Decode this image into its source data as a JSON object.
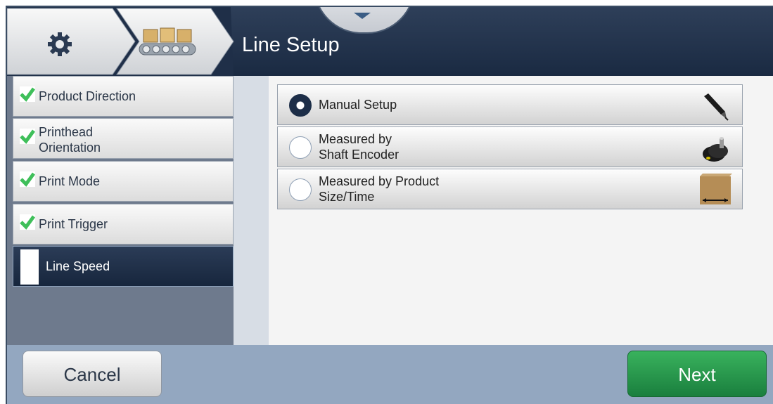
{
  "header": {
    "title": "Line Setup",
    "settings_icon": "gear-icon",
    "line_icon": "conveyor-icon"
  },
  "sidebar": {
    "items": [
      {
        "label": "Product Direction",
        "status": "complete"
      },
      {
        "label": "Printhead\nOrientation",
        "status": "complete"
      },
      {
        "label": "Print Mode",
        "status": "complete"
      },
      {
        "label": "Print Trigger",
        "status": "complete"
      },
      {
        "label": "Line Speed",
        "status": "active"
      }
    ]
  },
  "options": [
    {
      "label": "Manual Setup",
      "selected": true,
      "icon": "pen-icon"
    },
    {
      "label": "Measured by\nShaft Encoder",
      "selected": false,
      "icon": "shaft-encoder-icon"
    },
    {
      "label": "Measured by Product\nSize/Time",
      "selected": false,
      "icon": "product-box-icon"
    }
  ],
  "footer": {
    "cancel_label": "Cancel",
    "next_label": "Next"
  },
  "colors": {
    "header": "#1f2f48",
    "next": "#2a9a4c",
    "check": "#3fbf5a"
  }
}
